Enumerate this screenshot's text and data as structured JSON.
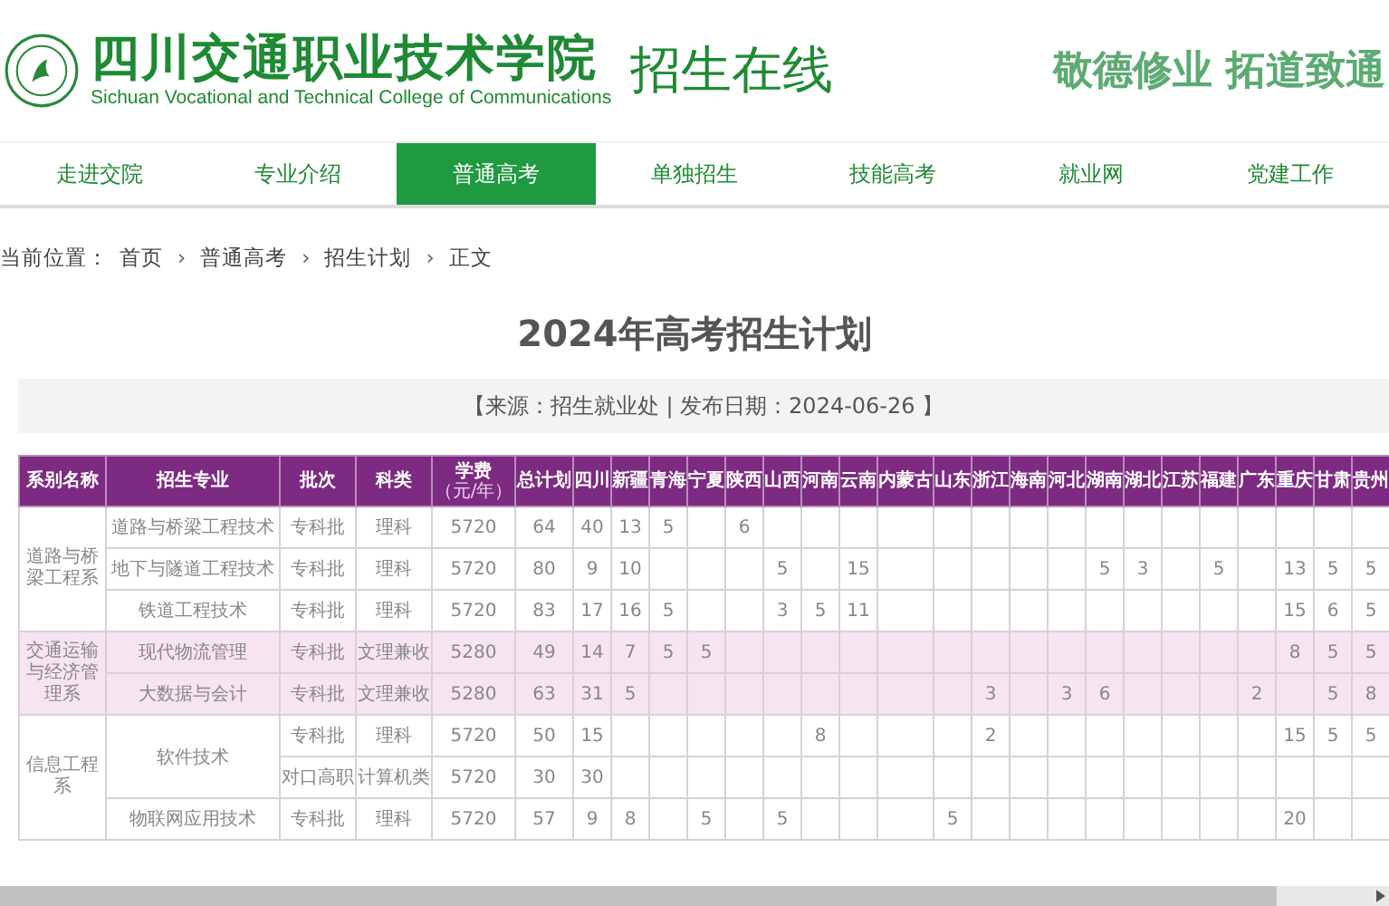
{
  "header": {
    "school_name": "四川交通职业技术学院",
    "school_name_en": "Sichuan Vocational and Technical College of Communications",
    "site_title": "招生在线",
    "slogan": "敬德修业 拓道致通"
  },
  "nav": [
    {
      "label": "走进交院",
      "selected": false
    },
    {
      "label": "专业介绍",
      "selected": false
    },
    {
      "label": "普通高考",
      "selected": true
    },
    {
      "label": "单独招生",
      "selected": false
    },
    {
      "label": "技能高考",
      "selected": false
    },
    {
      "label": "就业网",
      "selected": false
    },
    {
      "label": "党建工作",
      "selected": false
    }
  ],
  "breadcrumb": {
    "label": "当前位置：",
    "separator": "›",
    "items": [
      "首页",
      "普通高考",
      "招生计划",
      "正文"
    ]
  },
  "article": {
    "title": "2024年高考招生计划",
    "meta": "【来源：招生就业处 | 发布日期：2024-06-26 】"
  },
  "table": {
    "columns": [
      {
        "label": "系别名称"
      },
      {
        "label": "招生专业"
      },
      {
        "label": "批次"
      },
      {
        "label": "科类"
      },
      {
        "label": "学费",
        "sub": "（元/年）"
      },
      {
        "label": "总计划"
      },
      {
        "label": "四川"
      },
      {
        "label": "新疆"
      },
      {
        "label": "青海"
      },
      {
        "label": "宁夏"
      },
      {
        "label": "陕西"
      },
      {
        "label": "山西"
      },
      {
        "label": "河南"
      },
      {
        "label": "云南"
      },
      {
        "label": "内蒙古"
      },
      {
        "label": "山东"
      },
      {
        "label": "浙江"
      },
      {
        "label": "海南"
      },
      {
        "label": "河北"
      },
      {
        "label": "湖南"
      },
      {
        "label": "湖北"
      },
      {
        "label": "江苏"
      },
      {
        "label": "福建"
      },
      {
        "label": "广东"
      },
      {
        "label": "重庆"
      },
      {
        "label": "甘肃"
      },
      {
        "label": "贵州"
      }
    ],
    "departments": [
      {
        "name": "道路与桥梁工程系",
        "highlighted": false,
        "majors": [
          {
            "name": "道路与桥梁工程技术",
            "entries": [
              {
                "batch": "专科批",
                "category": "理科",
                "fee": "5720",
                "total": "64",
                "quotas": {
                  "column_7": "40",
                  "column_8": "13",
                  "column_9": "5",
                  "column_11": "6"
                }
              }
            ]
          },
          {
            "name": "地下与隧道工程技术",
            "entries": [
              {
                "batch": "专科批",
                "category": "理科",
                "fee": "5720",
                "total": "80",
                "quotas": {
                  "column_7": "9",
                  "column_8": "10",
                  "column_12": "5",
                  "column_14": "15",
                  "column_20": "5",
                  "column_21": "3",
                  "column_23": "5",
                  "column_25": "13",
                  "column_26": "5",
                  "column_27": "5"
                }
              }
            ]
          },
          {
            "name": "铁道工程技术",
            "entries": [
              {
                "batch": "专科批",
                "category": "理科",
                "fee": "5720",
                "total": "83",
                "quotas": {
                  "column_7": "17",
                  "column_8": "16",
                  "column_9": "5",
                  "column_12": "3",
                  "column_13": "5",
                  "column_14": "11",
                  "column_25": "15",
                  "column_26": "6",
                  "column_27": "5"
                }
              }
            ]
          }
        ]
      },
      {
        "name": "交通运输与经济管理系",
        "highlighted": true,
        "majors": [
          {
            "name": "现代物流管理",
            "entries": [
              {
                "batch": "专科批",
                "category": "文理兼收",
                "fee": "5280",
                "total": "49",
                "quotas": {
                  "column_7": "14",
                  "column_8": "7",
                  "column_9": "5",
                  "column_10": "5",
                  "column_25": "8",
                  "column_26": "5",
                  "column_27": "5"
                }
              }
            ]
          },
          {
            "name": "大数据与会计",
            "entries": [
              {
                "batch": "专科批",
                "category": "文理兼收",
                "fee": "5280",
                "total": "63",
                "quotas": {
                  "column_7": "31",
                  "column_8": "5",
                  "column_17": "3",
                  "column_19": "3",
                  "column_20": "6",
                  "column_24": "2",
                  "column_26": "5",
                  "column_27": "8"
                }
              }
            ]
          }
        ]
      },
      {
        "name": "信息工程系",
        "highlighted": false,
        "majors": [
          {
            "name": "软件技术",
            "entries": [
              {
                "batch": "专科批",
                "category": "理科",
                "fee": "5720",
                "total": "50",
                "quotas": {
                  "column_7": "15",
                  "column_13": "8",
                  "column_17": "2",
                  "column_25": "15",
                  "column_26": "5",
                  "column_27": "5"
                }
              },
              {
                "batch": "对口高职",
                "category": "计算机类",
                "fee": "5720",
                "total": "30",
                "quotas": {
                  "column_7": "30"
                }
              }
            ]
          },
          {
            "name": "物联网应用技术",
            "entries": [
              {
                "batch": "专科批",
                "category": "理科",
                "fee": "5720",
                "total": "57",
                "quotas": {
                  "column_7": "9",
                  "column_8": "8",
                  "column_10": "5",
                  "column_12": "5",
                  "column_16": "5",
                  "column_25": "20"
                }
              }
            ]
          }
        ]
      }
    ]
  }
}
